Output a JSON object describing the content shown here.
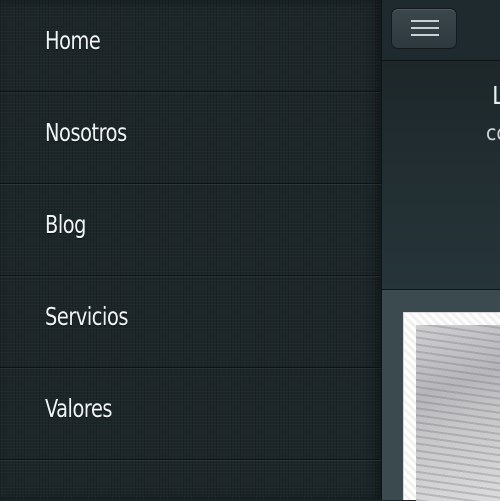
{
  "side_menu": {
    "items": [
      {
        "label": "Home"
      },
      {
        "label": "Nosotros"
      },
      {
        "label": "Blog"
      },
      {
        "label": "Servicios"
      },
      {
        "label": "Valores"
      }
    ]
  },
  "top_bar": {
    "menu_toggle_icon": "hamburger-menu-icon"
  },
  "hero": {
    "line1": "L",
    "line2": "co"
  },
  "colors": {
    "menu_bg": "#1c2629",
    "menu_text": "#f1f4f5",
    "toggle_bg": "#34424a",
    "photo_frame": "#ffffff"
  }
}
